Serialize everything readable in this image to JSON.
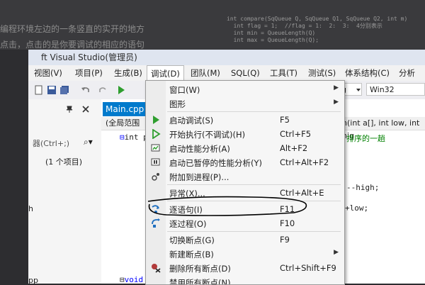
{
  "background": {
    "blurred_text_1": "编程环境左边的一条竖直的实开的地方",
    "blurred_text_2": "点击，点击的是你要调试的相应的语句",
    "code_lines": [
      "int compare(SqQueue Q, SqQueue Q1, SqQueue Q2, int m)",
      "  int flag = 1;  //flag = 1:  2:  3:  4分别表示",
      "  int min = QueueLength(Q)",
      "  int max = QueueLength(Q);"
    ]
  },
  "window": {
    "title": "ft Visual Studio(管理员)"
  },
  "menubar": {
    "items": [
      "视图(V)",
      "项目(P)",
      "生成(B)",
      "调试(D)",
      "团队(M)",
      "SQL(Q)",
      "工具(T)",
      "测试(S)",
      "体系结构(C)",
      "分析(N)"
    ]
  },
  "toolbar": {
    "config_value": "g",
    "platform_value": "Win32"
  },
  "left_panel": {
    "search_placeholder": "器(Ctrl+;)",
    "search_icon": "search-icon",
    "project_count": "(1 个项目)",
    "item_h": "h",
    "item_cpp": "pp"
  },
  "editor": {
    "tab_label": "Main.cpp",
    "scope_label": "(全局范围",
    "function_sig": "n(int a[], int low, int hig",
    "line_1": "int p",
    "comment": "排序的一趟",
    "line_high": "--high;",
    "line_low": "+low;",
    "line_void": "void"
  },
  "debug_menu": {
    "items": [
      {
        "label": "窗口(W)",
        "shortcut": "",
        "icon": "",
        "submenu": true
      },
      {
        "label": "图形",
        "shortcut": "",
        "icon": "",
        "submenu": true
      },
      {
        "label": "启动调试(S)",
        "shortcut": "F5",
        "icon": "play-icon",
        "submenu": false
      },
      {
        "label": "开始执行(不调试)(H)",
        "shortcut": "Ctrl+F5",
        "icon": "play-outline-icon",
        "submenu": false
      },
      {
        "label": "启动性能分析(A)",
        "shortcut": "Alt+F2",
        "icon": "performance-icon",
        "submenu": false
      },
      {
        "label": "启动已暂停的性能分析(Y)",
        "shortcut": "Ctrl+Alt+F2",
        "icon": "performance-paused-icon",
        "submenu": false
      },
      {
        "label": "附加到进程(P)...",
        "shortcut": "",
        "icon": "attach-process-icon",
        "submenu": false
      },
      {
        "label": "异常(X)...",
        "shortcut": "Ctrl+Alt+E",
        "icon": "",
        "submenu": false
      },
      {
        "label": "逐语句(I)",
        "shortcut": "F11",
        "icon": "step-into-icon",
        "submenu": false
      },
      {
        "label": "逐过程(O)",
        "shortcut": "F10",
        "icon": "step-over-icon",
        "submenu": false
      },
      {
        "label": "切换断点(G)",
        "shortcut": "F9",
        "icon": "",
        "submenu": false
      },
      {
        "label": "新建断点(B)",
        "shortcut": "",
        "icon": "",
        "submenu": true
      },
      {
        "label": "删除所有断点(D)",
        "shortcut": "Ctrl+Shift+F9",
        "icon": "delete-breakpoints-icon",
        "submenu": false
      },
      {
        "label": "禁用所有断点(N)",
        "shortcut": "",
        "icon": "",
        "submenu": false
      }
    ]
  },
  "colors": {
    "accent": "#007acc",
    "play_green": "#2f9e2f",
    "step_blue": "#1f6fbf"
  }
}
